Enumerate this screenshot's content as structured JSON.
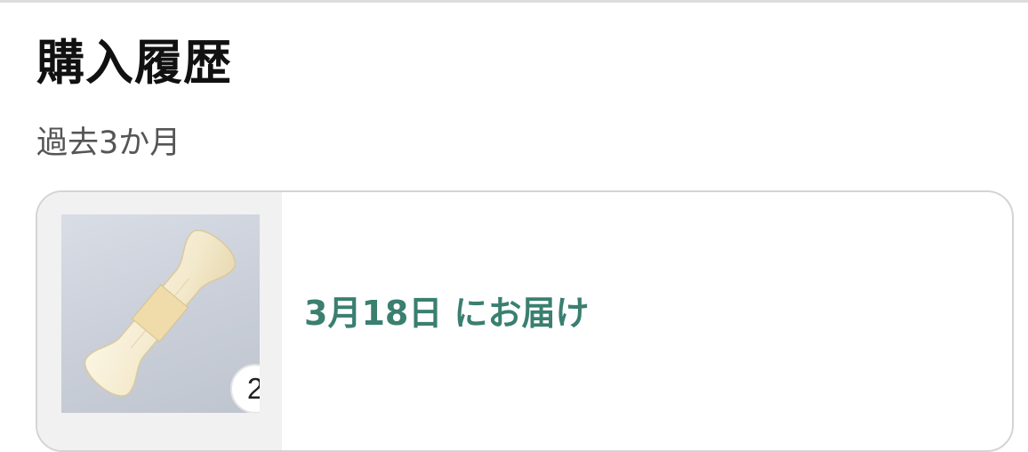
{
  "header": {
    "title": "購入履歴",
    "period": "過去3か月"
  },
  "order": {
    "quantity": "2",
    "delivery_status": "3月18日 にお届け",
    "product_image": "bone-shaped-pillow"
  },
  "colors": {
    "accent": "#3a7f70",
    "title": "#111111",
    "subtitle": "#555555",
    "card_border": "#d4d4d4",
    "thumb_panel": "#f1f1f1"
  }
}
